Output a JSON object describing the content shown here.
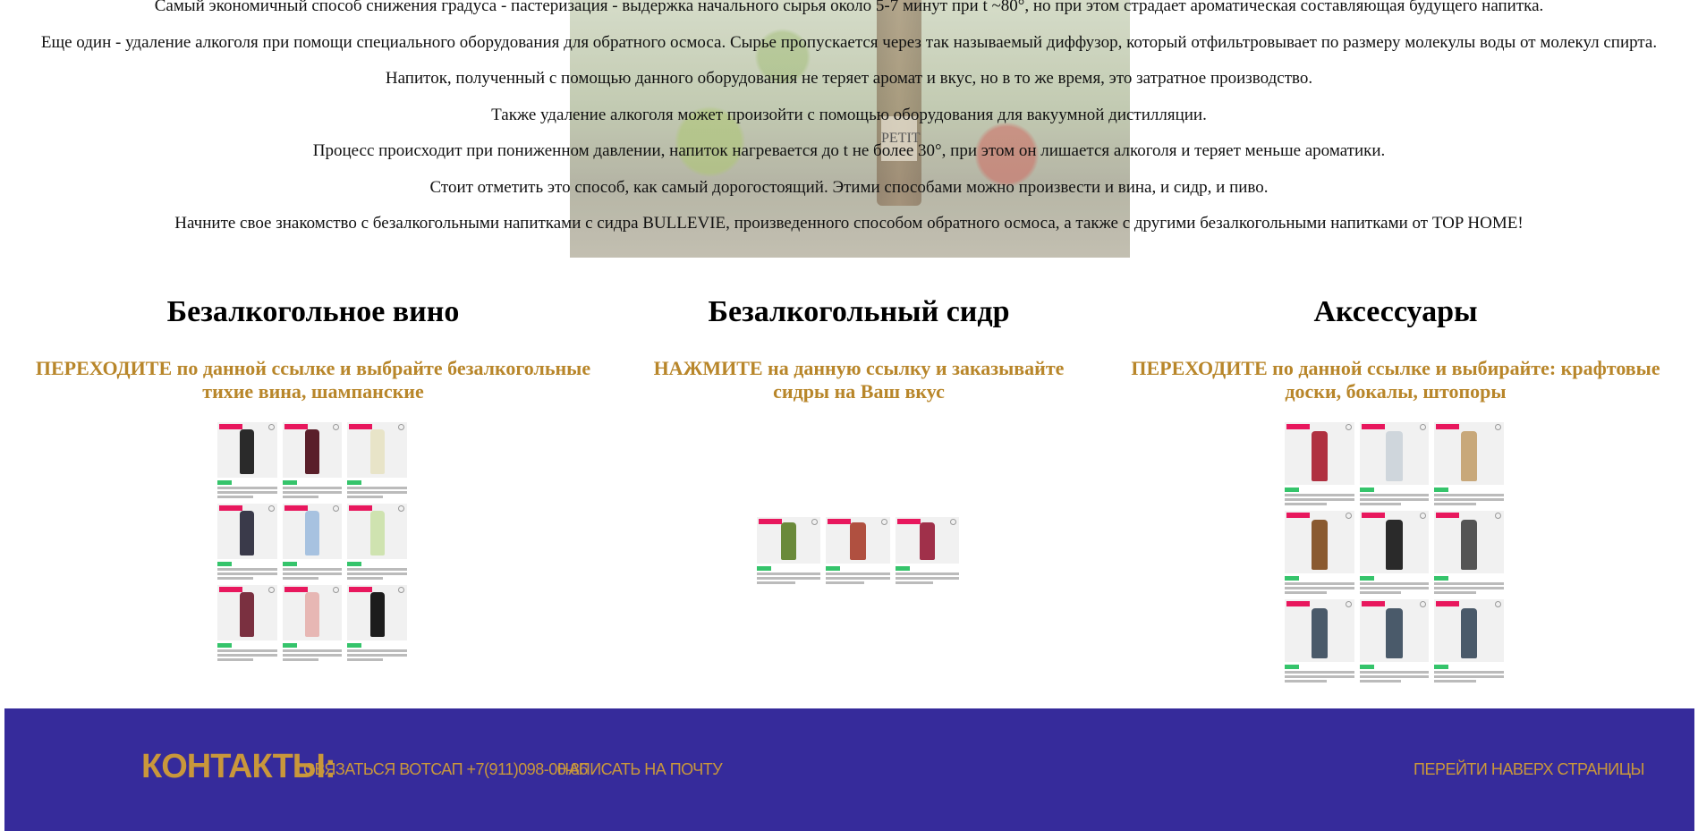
{
  "intro": {
    "paragraphs": [
      "Самый экономичный способ снижения градуса - пастеризация - выдержка начального сырья около 5-7 минут при t ~80°, но при этом страдает ароматическая составляющая будущего напитка.",
      "Еще один - удаление алкоголя при помощи специального оборудования для обратного осмоса. Сырье пропускается через так называемый диффузор, который отфильтровывает по размеру молекулы воды от молекул спирта.",
      "Напиток, полученный с помощью данного оборудования не теряет аромат и вкус, но в то же время, это затратное производство.",
      "Также удаление алкоголя может произойти с помощью оборудования для вакуумной дистилляции.",
      "Процесс происходит при пониженном давлении, напиток нагревается до t не более 30°, при этом он лишается алкоголя и теряет меньше ароматики.",
      "Стоит отметить это способ, как самый дорогостоящий. Этими способами можно произвести и вина, и сидр, и пиво.",
      "Начните свое знакомство с безалкогольными напитками с сидра BULLEVIE, произведенного способом обратного осмоса, а также с другими безалкогольными напитками от TOP HOME!"
    ],
    "bottle_label": "PETIT"
  },
  "columns": [
    {
      "title": "Безалкогольное вино",
      "link": "ПЕРЕХОДИТЕ по данной ссылке и выбрайте безалкогольные тихие вина, шампанские"
    },
    {
      "title": "Безалкогольный сидр",
      "link": "НАЖМИТЕ на данную ссылку и заказывайте сидры на Ваш вкус"
    },
    {
      "title": "Аксессуары",
      "link": "ПЕРЕХОДИТЕ по данной ссылке и выбирайте: крафтовые доски, бокалы, штопоры"
    }
  ],
  "footer": {
    "title": "КОНТАКТЫ:",
    "whatsapp": "СВЯЗАТЬСЯ ВОТСАП +7(911)098-00-86",
    "email": "НАПИСАТЬ НА ПОЧТУ",
    "top": "ПЕРЕЙТИ НАВЕРХ СТРАНИЦЫ"
  },
  "colors": {
    "accent": "#b8862a",
    "footer_bg": "#362b9b",
    "footer_text": "#c9973b"
  }
}
